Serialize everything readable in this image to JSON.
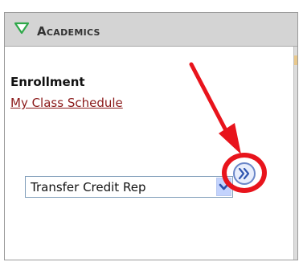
{
  "panel": {
    "title": "Academics",
    "collapse_icon": "triangle-down-icon"
  },
  "enrollment": {
    "heading": "Enrollment",
    "link": "My Class Schedule"
  },
  "select": {
    "value": "Transfer Credit Rep",
    "dropdown_icon": "chevron-down-icon"
  },
  "go_button": {
    "icon": "double-chevron-right-icon"
  },
  "annotation": {
    "arrow_icon": "red-arrow-icon",
    "highlight": "red-circle-highlight",
    "color": "#e8141c"
  },
  "colors": {
    "header_bg": "#d4d4d4",
    "link": "#8b1a1a",
    "collapse_icon": "#2fa84a"
  }
}
